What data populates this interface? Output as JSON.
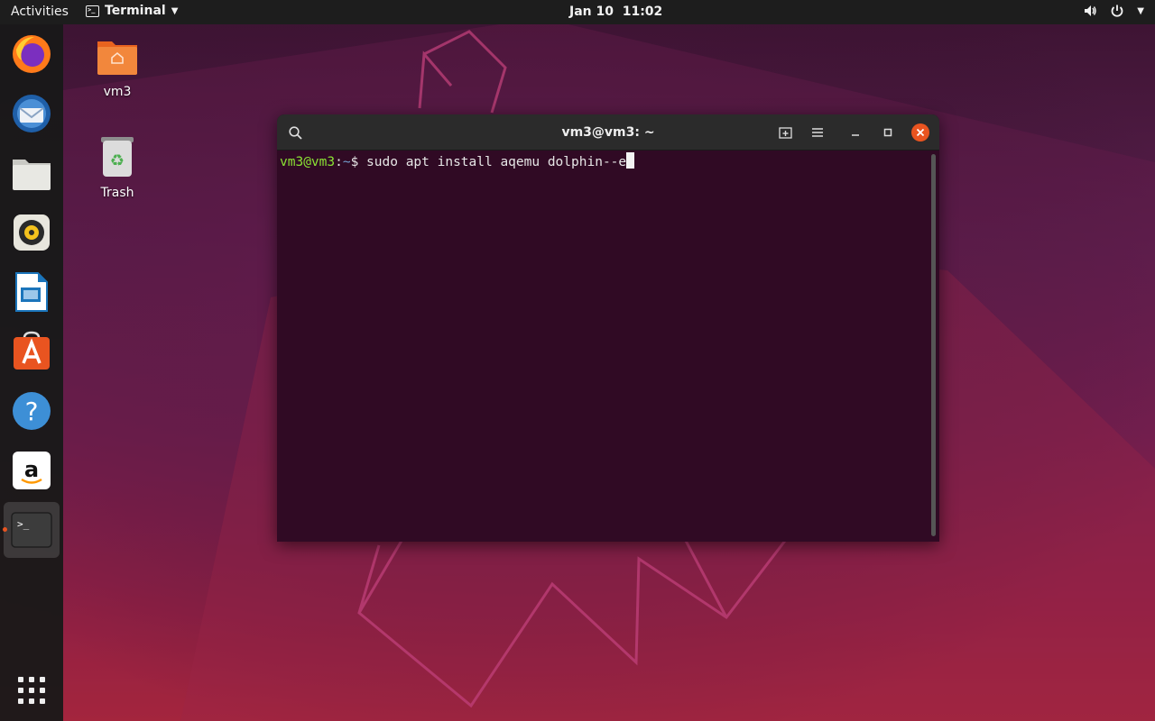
{
  "topbar": {
    "activities": "Activities",
    "app_name": "Terminal",
    "clock": "Jan 10  11:02"
  },
  "dock": {
    "items": [
      {
        "name": "Firefox",
        "icon": "firefox-icon"
      },
      {
        "name": "Thunderbird",
        "icon": "thunderbird-icon"
      },
      {
        "name": "Files",
        "icon": "files-icon"
      },
      {
        "name": "Rhythmbox",
        "icon": "rhythmbox-icon"
      },
      {
        "name": "LibreOffice Writer",
        "icon": "writer-icon"
      },
      {
        "name": "Ubuntu Software",
        "icon": "software-icon"
      },
      {
        "name": "Help",
        "icon": "help-icon"
      },
      {
        "name": "Amazon",
        "icon": "amazon-icon"
      },
      {
        "name": "Terminal",
        "icon": "terminal-icon"
      },
      {
        "name": "Show Applications",
        "icon": "apps-grid-icon"
      }
    ],
    "terminal_glyph": ">_",
    "help_glyph": "?",
    "amazon_glyph": "a"
  },
  "desktop": {
    "home_label": "vm3",
    "trash_label": "Trash"
  },
  "terminal": {
    "title": "vm3@vm3: ~",
    "prompt_user": "vm3@vm3",
    "prompt_sep": ":",
    "prompt_path": "~",
    "prompt_dollar": "$ ",
    "command": "sudo apt install aqemu dolphin--e"
  },
  "colors": {
    "accent": "#e95420",
    "terminal_bg": "#300a24",
    "prompt_user": "#8ae234",
    "prompt_path": "#729fcf"
  }
}
